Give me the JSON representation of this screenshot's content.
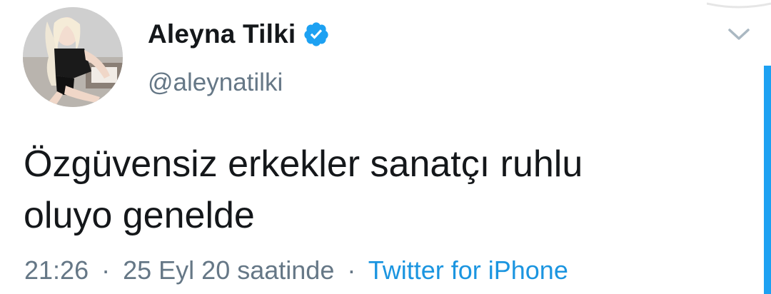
{
  "tweet": {
    "author": {
      "display_name": "Aleyna Tilki",
      "handle": "@aleynatilki",
      "verified_icon": "verified-badge-icon",
      "avatar_icon": "profile-photo"
    },
    "text": "Özgüvensiz erkekler sanatçı ruhlu\noluyo genelde",
    "meta": {
      "time": "21:26",
      "separator": "·",
      "date": "25 Eyl 20 saatinde",
      "source": "Twitter for iPhone"
    },
    "menu_icon": "chevron-down-icon"
  },
  "colors": {
    "text_primary": "#14171a",
    "text_secondary": "#657786",
    "link": "#1b95e0",
    "verified": "#1da1f2",
    "background": "#ffffff"
  }
}
